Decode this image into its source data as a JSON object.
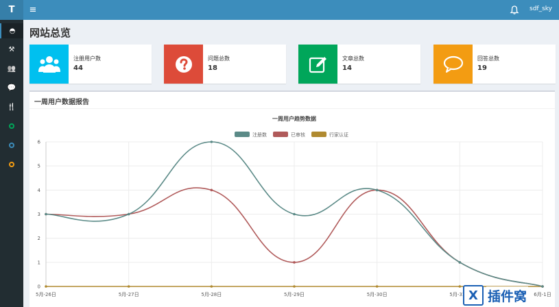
{
  "header": {
    "logo": "T",
    "menu_icon": "≡",
    "username": "sdf_sky"
  },
  "sidebar": {
    "items": [
      {
        "name": "dashboard-icon",
        "kind": "glyph",
        "glyph": "◓"
      },
      {
        "name": "wrench-icon",
        "kind": "glyph",
        "glyph": "⚒"
      },
      {
        "name": "users-icon",
        "kind": "glyph",
        "glyph": "👥"
      },
      {
        "name": "comments-icon",
        "kind": "glyph",
        "glyph": "💬"
      },
      {
        "name": "cutlery-icon",
        "kind": "glyph",
        "glyph": "🍴"
      },
      {
        "name": "green-circle-icon",
        "kind": "ring",
        "color": "#00a65a"
      },
      {
        "name": "blue-circle-icon",
        "kind": "ring",
        "color": "#3c8dbc"
      },
      {
        "name": "orange-circle-icon",
        "kind": "ring",
        "color": "#f39c12"
      }
    ]
  },
  "page": {
    "title": "网站总览"
  },
  "stats": [
    {
      "label": "注册用户数",
      "value": "44",
      "color": "#00c0ef",
      "icon": "users-icon"
    },
    {
      "label": "问题总数",
      "value": "18",
      "color": "#dd4b39",
      "icon": "question-icon"
    },
    {
      "label": "文章总数",
      "value": "14",
      "color": "#00a65a",
      "icon": "edit-icon"
    },
    {
      "label": "回答总数",
      "value": "19",
      "color": "#f39c12",
      "icon": "comment-icon"
    }
  ],
  "chart_box": {
    "title": "一周用户数据报告"
  },
  "chart_data": {
    "type": "line",
    "title": "一周用户趋势数据",
    "categories": [
      "5月-26日",
      "5月-27日",
      "5月-28日",
      "5月-29日",
      "5月-30日",
      "5月-31日",
      "6月-1日"
    ],
    "ylim": [
      0,
      6
    ],
    "yticks": [
      0,
      1,
      2,
      3,
      4,
      5,
      6
    ],
    "grid": true,
    "legend_position": "top",
    "series": [
      {
        "name": "注册数",
        "color": "#5b8a87",
        "values": [
          3,
          3,
          6,
          3,
          4,
          1,
          0
        ]
      },
      {
        "name": "已审核",
        "color": "#b05a5a",
        "values": [
          3,
          3,
          4,
          1,
          4,
          1,
          0
        ]
      },
      {
        "name": "行家认证",
        "color": "#b08a30",
        "values": [
          0,
          0,
          0,
          0,
          0,
          0,
          0
        ]
      }
    ]
  },
  "watermark": {
    "icon": "X",
    "text": "插件窝"
  }
}
